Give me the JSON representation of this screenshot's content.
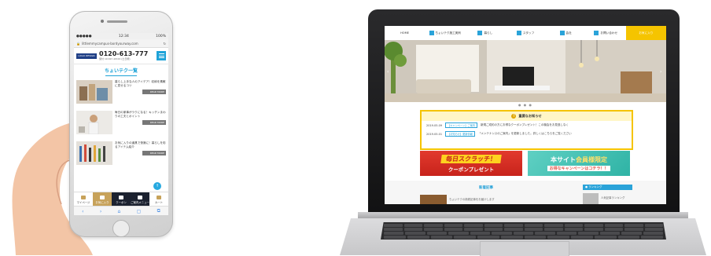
{
  "phone": {
    "status_carrier": "●●●●● ",
    "status_time": "12:34",
    "status_battery": "100%",
    "url": "littlemmycampus-bordyourway.com",
    "logo_text": "LOGO DESIGN",
    "tel": "0120-613-777",
    "tel_sub": "受付 10:00〜18:00 (土日祝)",
    "section_title": "ちょいテク一覧",
    "articles": [
      {
        "text": "暮らし上手な人のアイデア！収納を素敵に見せるコツ",
        "more": "READ MORE"
      },
      {
        "text": "毎日の家事がラクになる！キッチンまわりの工夫とポイント",
        "more": "READ MORE"
      },
      {
        "text": "お気に入りの道具で快適に！暮らしを彩るアイテム紹介",
        "more": "READ MORE"
      }
    ],
    "tabs": [
      "マイページ",
      "お気に入り",
      "クーポン",
      "ご案内メニュー",
      "カート"
    ],
    "nav_icons": [
      "‹",
      "›",
      "⌂",
      "▢",
      "⧉"
    ],
    "fab": "↑"
  },
  "laptop": {
    "nav": [
      "HOME",
      "ちょいテク施工実例",
      "暮らし",
      "スタッフ",
      "会社",
      "お問い合わせ",
      "お気に入り"
    ],
    "hero_dots": "● ● ●",
    "news_title": "重要なお知らせ",
    "news": [
      {
        "date": "2019.05.09",
        "cat": "【キャンペーン】ご案内",
        "text": "新規ご成約の方にお得なクーポンプレゼント！この機会をお見逃しなく"
      },
      {
        "date": "2019.05.01",
        "cat": "【お知らせ】更新情報",
        "text": "「メンテナンスのご案内」を更新しました。詳しくはこちらをご覧ください"
      }
    ],
    "banner1_title": "毎日スクラッチ！",
    "banner1_sub": "クーポンプレゼント",
    "banner2_title_a": "本サイト",
    "banner2_title_b": "会員様限定",
    "banner2_sub": "お得なキャンペーンはコチラ！！",
    "lower_heading": "新着記事",
    "lower_side": "● ランキング",
    "lower_text": "ちょいテクの新着記事をお届けします",
    "lower_side_text": "人気記事ランキング"
  }
}
